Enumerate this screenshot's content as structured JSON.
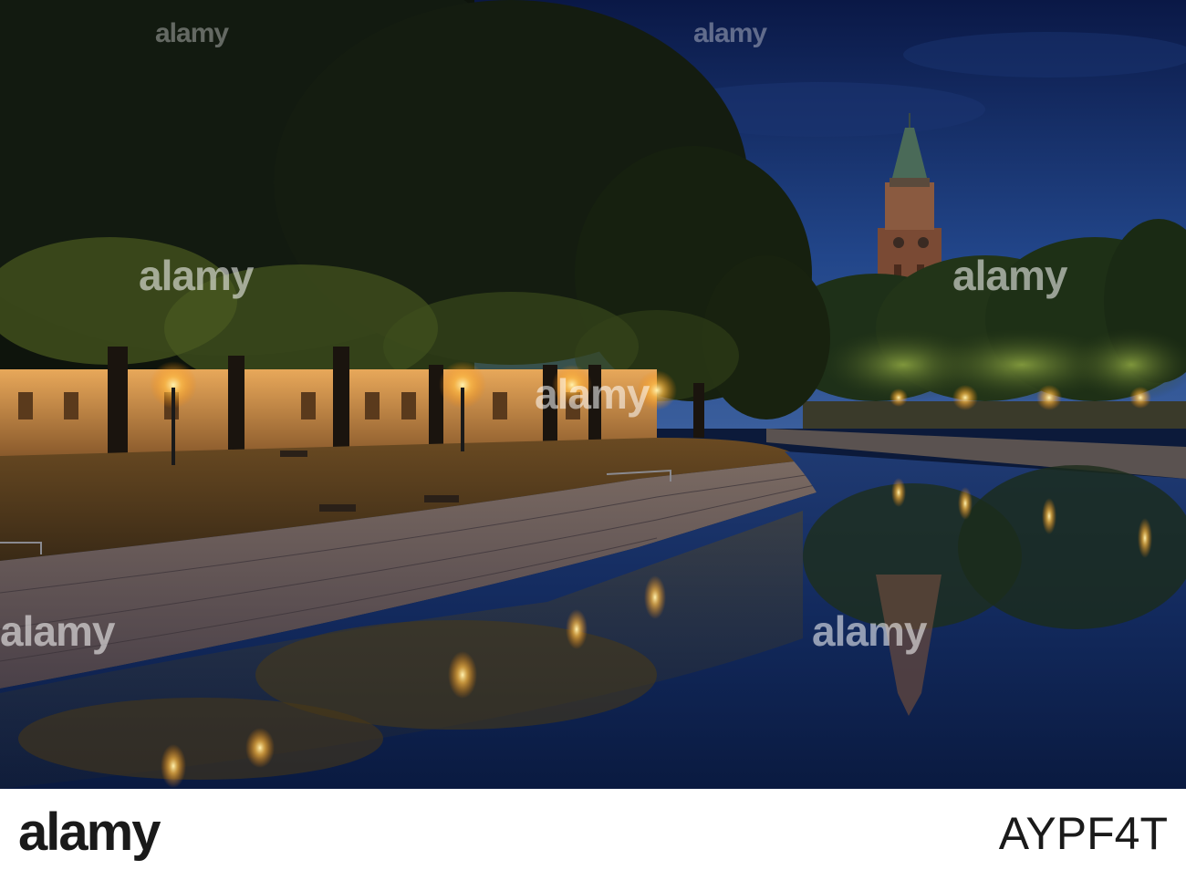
{
  "scene": {
    "description_colors": {
      "sky_top": "#0b1a4a",
      "sky_bottom": "#2c4e8e",
      "lamp_glow": "#ffcc55",
      "tree_dark": "#141a12",
      "water": "#0f2048"
    }
  },
  "watermarks": {
    "text": "alamy"
  },
  "footer": {
    "brand": "alamy",
    "image_id": "AYPF4T"
  }
}
